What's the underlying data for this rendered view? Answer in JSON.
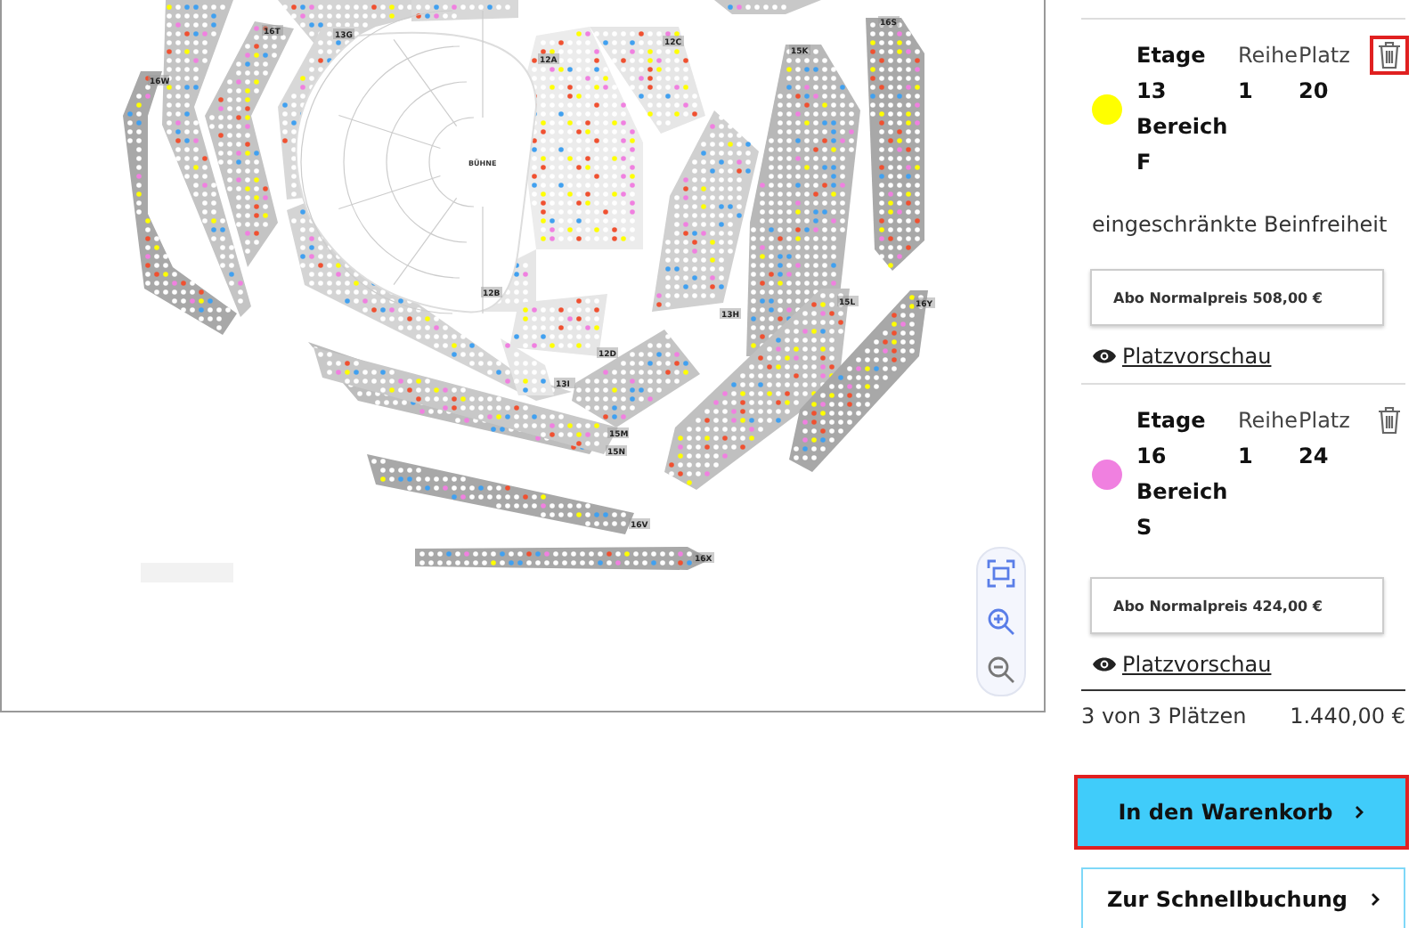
{
  "seat_map": {
    "stage_label": "BÜHNE",
    "sections": [
      {
        "label": "16W"
      },
      {
        "label": "16T"
      },
      {
        "label": "13G"
      },
      {
        "label": "12A"
      },
      {
        "label": "12C"
      },
      {
        "label": "16S"
      },
      {
        "label": "15K"
      },
      {
        "label": "13H"
      },
      {
        "label": "12B"
      },
      {
        "label": "12D"
      },
      {
        "label": "13I"
      },
      {
        "label": "15L"
      },
      {
        "label": "16Y"
      },
      {
        "label": "15M"
      },
      {
        "label": "15N"
      },
      {
        "label": "16V"
      },
      {
        "label": "16X"
      }
    ],
    "zoom_controls": [
      {
        "kind": "fit"
      },
      {
        "kind": "zoom_in"
      },
      {
        "kind": "zoom_out"
      }
    ]
  },
  "cart": {
    "items": [
      {
        "color": "#ffff00",
        "floor_label": "Etage",
        "floor": "13",
        "row_label": "Reihe",
        "row": "1",
        "seat_label": "Platz",
        "seat": "20",
        "area_label": "Bereich",
        "area": "F",
        "note": "eingeschränkte Beinfreiheit",
        "price": "Abo Normalpreis 508,00 €",
        "preview_link": "Platzvorschau",
        "delete_highlighted": true
      },
      {
        "color": "#f080e0",
        "floor_label": "Etage",
        "floor": "16",
        "row_label": "Reihe",
        "row": "1",
        "seat_label": "Platz",
        "seat": "24",
        "area_label": "Bereich",
        "area": "S",
        "price": "Abo Normalpreis 424,00 €",
        "preview_link": "Platzvorschau",
        "delete_highlighted": false
      }
    ],
    "summary": {
      "count": "3 von 3 Plätzen",
      "total": "1.440,00 €"
    },
    "buttons": [
      {
        "label": "In den Warenkorb",
        "kind": "primary",
        "highlighted": true
      },
      {
        "label": "Zur Schnellbuchung",
        "kind": "secondary",
        "highlighted": false
      }
    ]
  }
}
